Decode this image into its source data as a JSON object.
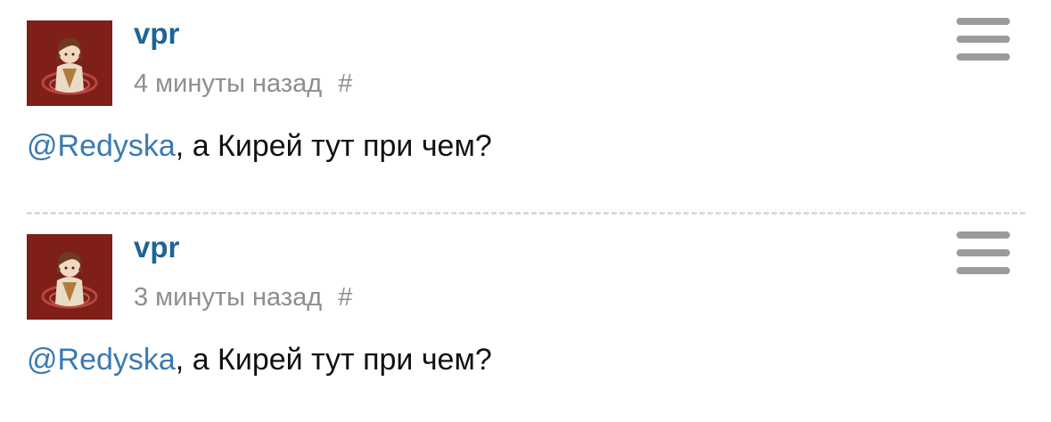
{
  "colors": {
    "username": "#1e6496",
    "mention": "#3a7ab3",
    "meta": "#8e8e8e",
    "avatar_bg": "#7e1f18",
    "menu_icon": "#9b9b9b",
    "divider": "#dcdcdc"
  },
  "comments": [
    {
      "author": "vpr",
      "time": "4 минуты назад",
      "permalink": "#",
      "mention": "@Redyska",
      "text": ", а Кирей тут при чем?",
      "avatar_icon": "user-avatar-icon",
      "menu_icon": "hamburger-menu-icon"
    },
    {
      "author": "vpr",
      "time": "3 минуты назад",
      "permalink": "#",
      "mention": "@Redyska",
      "text": ", а Кирей тут при чем?",
      "avatar_icon": "user-avatar-icon",
      "menu_icon": "hamburger-menu-icon"
    }
  ]
}
